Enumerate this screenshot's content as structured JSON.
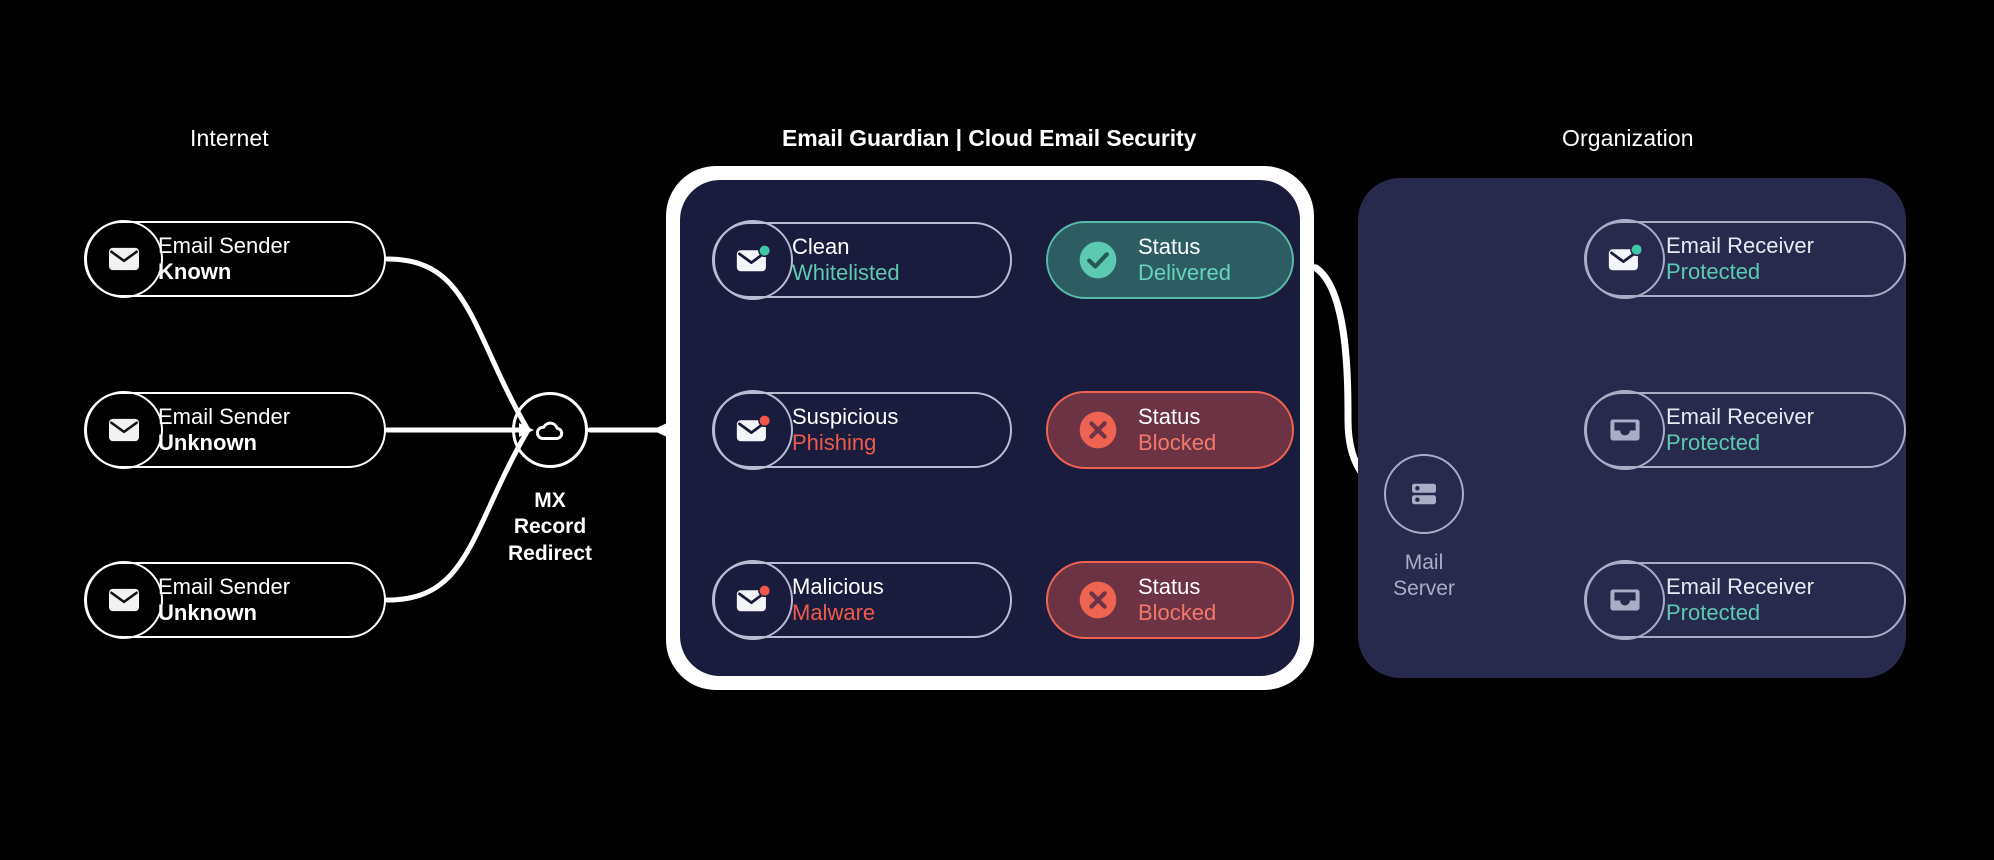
{
  "diagram": {
    "title": "Email Guardian Cloud Email Security Mail Flow",
    "background": "#000000"
  },
  "colors": {
    "white": "#ffffff",
    "panel_center_fill": "#1a1c3d",
    "panel_center_border": "#ffffff",
    "panel_org_fill": "#272a4c",
    "teal": "#5cc9b0",
    "teal_badge_bg": "#2d5d63",
    "teal_badge_border": "#57b9a8",
    "red": "#f05a4a",
    "red_badge_bg": "#6b3344",
    "red_badge_border": "#ef6352",
    "muted_line": "#a9aec7"
  },
  "sections": {
    "internet": {
      "label": "Internet"
    },
    "guardian": {
      "label": "Email Guardian | Cloud Email Security"
    },
    "organization": {
      "label": "Organization"
    }
  },
  "senders": [
    {
      "icon": "envelope-icon",
      "line1": "Email Sender",
      "line2": "Known"
    },
    {
      "icon": "envelope-icon",
      "line1": "Email Sender",
      "line2": "Unknown"
    },
    {
      "icon": "envelope-icon",
      "line1": "Email Sender",
      "line2": "Unknown"
    }
  ],
  "mx": {
    "icon": "cloud-icon",
    "caption_line1": "MX",
    "caption_line2": "Record",
    "caption_line3": "Redirect"
  },
  "scans": [
    {
      "icon": "envelope-dot-green-icon",
      "line1": "Clean",
      "line2": "Whitelisted",
      "verdict_color": "teal",
      "status": {
        "icon": "check-circle-icon",
        "line1": "Status",
        "line2": "Delivered",
        "variant": "delivered"
      }
    },
    {
      "icon": "envelope-dot-red-icon",
      "line1": "Suspicious",
      "line2": "Phishing",
      "verdict_color": "red",
      "status": {
        "icon": "x-circle-icon",
        "line1": "Status",
        "line2": "Blocked",
        "variant": "blocked"
      }
    },
    {
      "icon": "envelope-dot-red-icon",
      "line1": "Malicious",
      "line2": "Malware",
      "verdict_color": "red",
      "status": {
        "icon": "x-circle-icon",
        "line1": "Status",
        "line2": "Blocked",
        "variant": "blocked"
      }
    }
  ],
  "mail_server": {
    "icon": "server-icon",
    "caption_line1": "Mail",
    "caption_line2": "Server"
  },
  "receivers": [
    {
      "icon": "envelope-dot-green-icon",
      "line1": "Email Receiver",
      "line2": "Protected"
    },
    {
      "icon": "inbox-icon",
      "line1": "Email Receiver",
      "line2": "Protected"
    },
    {
      "icon": "inbox-icon",
      "line1": "Email Receiver",
      "line2": "Protected"
    }
  ]
}
